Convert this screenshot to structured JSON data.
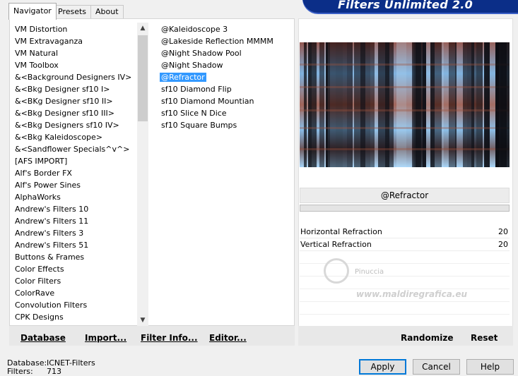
{
  "header": {
    "title": "Filters Unlimited 2.0"
  },
  "tabs": [
    {
      "label": "Navigator",
      "active": true
    },
    {
      "label": "Presets",
      "active": false
    },
    {
      "label": "About",
      "active": false
    }
  ],
  "categories": [
    "VM Distortion",
    "VM Extravaganza",
    "VM Natural",
    "VM Toolbox",
    "&<Background Designers IV>",
    "&<Bkg Designer sf10 I>",
    "&<BKg Designer sf10 II>",
    "&<Bkg Designer sf10 III>",
    "&<Bkg Designers sf10 IV>",
    "&<Bkg Kaleidoscope>",
    "&<Sandflower Specials^v^>",
    "[AFS IMPORT]",
    "Alf's Border FX",
    "Alf's Power Sines",
    "AlphaWorks",
    "Andrew's Filters 10",
    "Andrew's Filters 11",
    "Andrew's Filters 3",
    "Andrew's Filters 51",
    "Buttons & Frames",
    "Color Effects",
    "Color Filters",
    "ColorRave",
    "Convolution Filters",
    "CPK Designs"
  ],
  "filters": [
    "@Kaleidoscope 3",
    "@Lakeside Reflection MMMM",
    "@Night Shadow Pool",
    "@Night Shadow",
    "@Refractor",
    "sf10 Diamond Flip",
    "sf10 Diamond Mountian",
    "sf10 Slice N Dice",
    "sf10 Square Bumps"
  ],
  "selected_filter_index": 4,
  "left_buttons": {
    "database": "Database",
    "import": "Import...",
    "filter_info": "Filter Info...",
    "editor": "Editor..."
  },
  "current_filter": "@Refractor",
  "params": [
    {
      "label": "Horizontal Refraction",
      "value": "20"
    },
    {
      "label": "Vertical Refraction",
      "value": "20"
    }
  ],
  "watermark": {
    "name": "Pinuccia",
    "url": "www.maldiregrafica.eu"
  },
  "right_buttons": {
    "randomize": "Randomize",
    "reset": "Reset"
  },
  "status": {
    "database_label": "Database:",
    "database_value": "ICNET-Filters",
    "filters_label": "Filters:",
    "filters_value": "713"
  },
  "dialog_buttons": {
    "apply": "Apply",
    "cancel": "Cancel",
    "help": "Help"
  }
}
